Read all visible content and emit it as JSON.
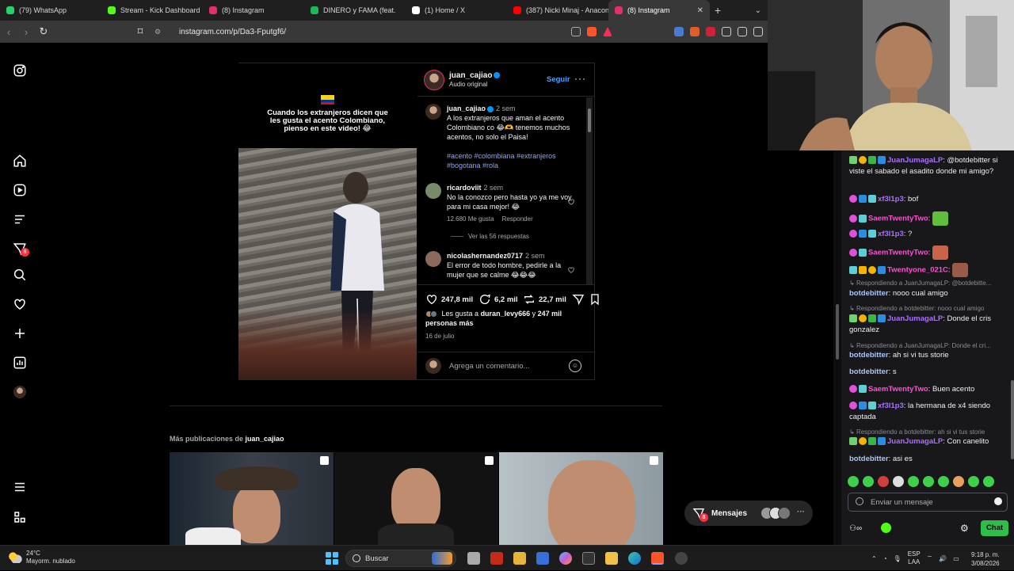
{
  "browser": {
    "tabs": [
      {
        "label": "(79) WhatsApp",
        "color": "#25d366"
      },
      {
        "label": "Stream - Kick Dashboard",
        "color": "#53fc18"
      },
      {
        "label": "(8) Instagram",
        "color": "#e1306c"
      },
      {
        "label": "DINERO y FAMA (feat.",
        "color": "#1db954"
      },
      {
        "label": "(1) Home / X",
        "color": "#ffffff"
      },
      {
        "label": "(387) Nicki Minaj - Anacon",
        "color": "#ff0000"
      },
      {
        "label": "(8) Instagram",
        "color": "#e1306c",
        "active": true
      }
    ],
    "url": "instagram.com/p/Da3-Fputgf6/"
  },
  "nav": {
    "items": [
      "instagram-logo",
      "home-icon",
      "reels-icon",
      "explore-icon",
      "messages-icon",
      "search-icon",
      "notifications-icon",
      "create-icon",
      "dashboard-icon",
      "profile-avatar",
      "menu-icon",
      "threads-icon"
    ],
    "messages_badge": "8"
  },
  "post": {
    "media_caption": "Cuando los extranjeros dicen que les gusta el acento Colombiano, pienso en este video! 😂",
    "header": {
      "username": "juan_cajiao",
      "audio": "Audio original",
      "follow": "Seguir",
      "more": "···"
    },
    "caption": {
      "username": "juan_cajiao",
      "time": "2 sem",
      "text": "A los extranjeros que aman el acento Colombiano co 😂🫶 tenemos muchos acentos, no solo el Paisa!",
      "hashtags": "#acento #colombiana #extranjeros #bogotana #rola"
    },
    "comments": [
      {
        "username": "ricardoviit",
        "time": "2 sem",
        "text": "No la conozco pero hasta yo ya me voy para mi casa mejor! 😂",
        "likes": "12.680 Me gusta",
        "reply": "Responder"
      },
      {
        "username": "nicolashernandez0717",
        "time": "2 sem",
        "text": "El error de todo hombre, pedirle a la mujer que se calme 😂😂😂"
      }
    ],
    "view_replies": "Ver las 56 respuestas",
    "stats": {
      "likes": "247,8 mil",
      "comments": "6,2 mil",
      "reposts": "22,7 mil"
    },
    "liked_by_prefix": "Les gusta a ",
    "liked_by_user": "duran_levy666",
    "liked_by_suffix": " y ",
    "liked_by_count": "247 mil personas más",
    "date": "16 de julio",
    "add_comment_placeholder": "Agrega un comentario..."
  },
  "more_posts": {
    "label": "Más publicaciones de ",
    "user": "juan_cajiao"
  },
  "messages": {
    "label": "Mensajes",
    "badge": "8",
    "more": "···"
  },
  "chat": {
    "lines": [
      {
        "name": "JuanJumagaLP",
        "color": "#a970ff",
        "text": ": @botdebitter si viste el sabado el asadito donde mi amigo?"
      },
      {
        "name": "xf3l1p3",
        "color": "#a970ff",
        "text": ": bof"
      },
      {
        "name": "SaemTwentyTwo",
        "color": "#ff4fd8",
        "text": ": "
      },
      {
        "name": "xf3l1p3",
        "color": "#a970ff",
        "text": ": ?"
      },
      {
        "name": "SaemTwentyTwo",
        "color": "#ff4fd8",
        "text": ": "
      },
      {
        "name": "Twentyone_021C",
        "color": "#ff4fd8",
        "text": ": "
      },
      {
        "name": "botdebitter",
        "color": "#a9c6ff",
        "text": ": nooo cual amigo"
      },
      {
        "name": "JuanJumagaLP",
        "color": "#a970ff",
        "text": ": Donde el cris gonzalez"
      },
      {
        "name": "botdebitter",
        "color": "#a9c6ff",
        "text": ": ah si vi tus storie"
      },
      {
        "name": "botdebitter",
        "color": "#a9c6ff",
        "text": ": s"
      },
      {
        "name": "SaemTwentyTwo",
        "color": "#ff4fd8",
        "text": ": Buen acento"
      },
      {
        "name": "xf3l1p3",
        "color": "#a970ff",
        "text": ": la hermana de x4 siendo captada"
      },
      {
        "name": "JuanJumagaLP",
        "color": "#a970ff",
        "text": ": Con canelito"
      },
      {
        "name": "botdebitter",
        "color": "#a9c6ff",
        "text": ": asi es"
      }
    ],
    "reply_hints": [
      "Respondiendo a JuanJumagaLP: @botdebitte...",
      "Respondiendo a botdebitter: nooo cual amigo",
      "Respondiendo a JuanJumagaLP: Donde el cri...",
      "Respondiendo a botdebitter: ah si vi tus storie"
    ],
    "input_placeholder": "Enviar un mensaje",
    "send_label": "Chat"
  },
  "taskbar": {
    "temp": "24°C",
    "weather": "Mayorm. nublado",
    "search": "Buscar",
    "lang1": "ESP",
    "lang2": "LAA",
    "time": "9:18 p. m.",
    "date": "3/08/2026"
  }
}
